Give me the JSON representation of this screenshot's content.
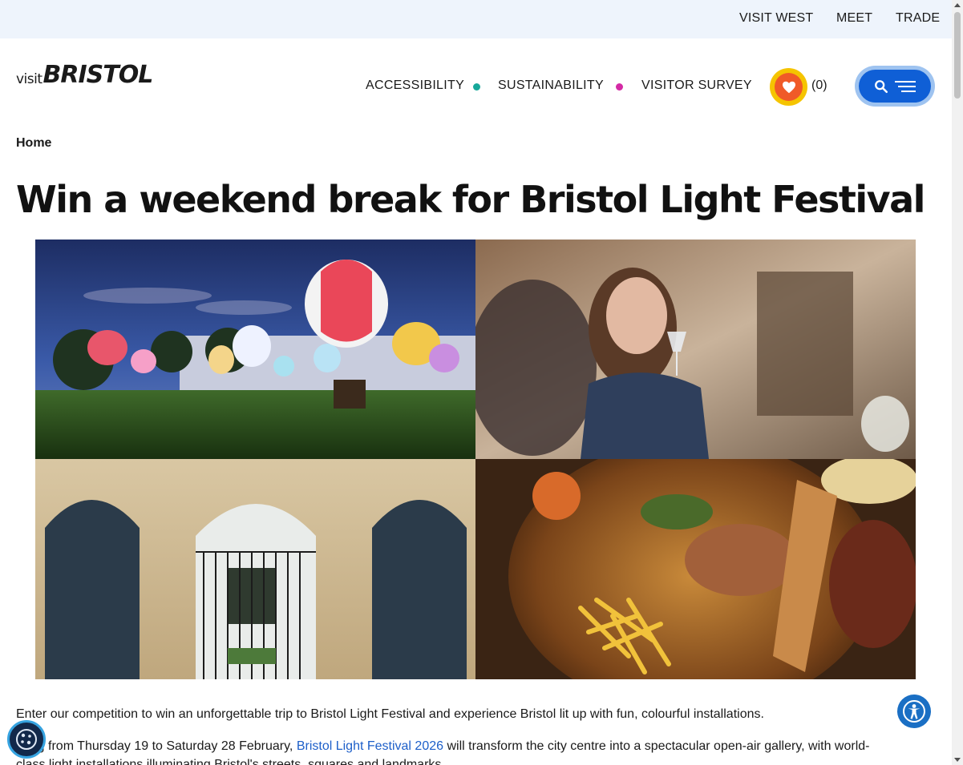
{
  "topbar": {
    "links": [
      "VISIT WEST",
      "MEET",
      "TRADE"
    ]
  },
  "logo": {
    "small": "visit",
    "big": "BRISTOL"
  },
  "nav": {
    "items": [
      "ACCESSIBILITY",
      "SUSTAINABILITY",
      "VISITOR SURVEY"
    ],
    "dot_colors": [
      "#17a89a",
      "#d42aa5"
    ]
  },
  "favourites": {
    "count": "(0)",
    "ring_color": "#f5c400",
    "fill_color": "#f05a28"
  },
  "menu": {
    "color": "#0f5fd6"
  },
  "breadcrumb": {
    "home": "Home"
  },
  "page": {
    "title": "Win a weekend break for Bristol Light Festival"
  },
  "gallery": {
    "images": [
      "balloons-night-image",
      "woman-wine-image",
      "hotel-arch-image",
      "food-platter-image"
    ]
  },
  "body": {
    "p1": "Enter our competition to win an unforgettable trip to Bristol Light Festival and experience Bristol lit up with fun, colourful installations.",
    "p2_before": "rning from Thursday 19 to Saturday 28 February, ",
    "p2_link": "Bristol Light Festival 2026",
    "p2_after": " will transform the city centre into a spectacular open-air gallery, with world-",
    "p3": "class light installations illuminating Bristol's streets, squares and landmarks."
  },
  "widgets": {
    "accessibility_color": "#1a6fc4",
    "cookie_color": "#12284a"
  }
}
